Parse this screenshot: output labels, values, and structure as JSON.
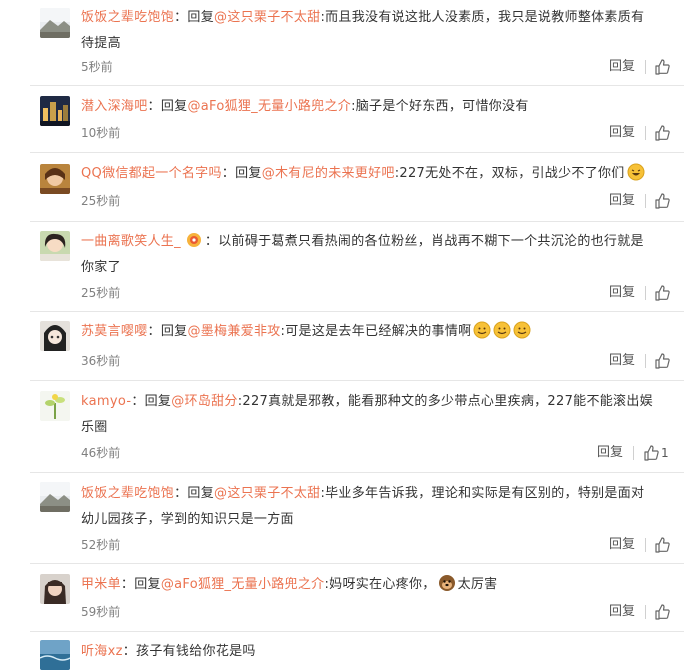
{
  "reply_label": "回复",
  "colon": "：",
  "comments": [
    {
      "user": "饭饭之辈吃饱饱",
      "prefix": "回复",
      "mention": "@这只栗子不太甜",
      "body_line1": ":而且我没有说这批人没素质，我只是说教师整体素质有",
      "body_line2": "待提高",
      "time": "5秒前",
      "avatar": "landscape"
    },
    {
      "user": "潜入深海吧",
      "prefix": "回复",
      "mention": "@aFo狐狸_无量小路兜之介",
      "body_line1": ":脑子是个好东西，可惜你没有",
      "time": "10秒前",
      "avatar": "night-city"
    },
    {
      "user": "QQ微信都起一个名字吗",
      "prefix": "回复",
      "mention": "@木有尼的未来更好吧",
      "body_line1": ":227无处不在，双标，引战少不了你们",
      "time": "25秒前",
      "avatar": "portrait"
    },
    {
      "user": "一曲离歌笑人生_",
      "body_line1": "以前碍于葛煮只看热闹的各位粉丝，肖战再不糊下一个共沉沦的也行就是",
      "body_line2": "你家了",
      "time": "25秒前",
      "avatar": "girl"
    },
    {
      "user": "苏莫言嘤嘤",
      "prefix": "回复",
      "mention": "@墨梅兼爱非攻",
      "body_line1": ":可是这是去年已经解决的事情啊",
      "time": "36秒前",
      "avatar": "anime"
    },
    {
      "user": "kamyo-",
      "prefix": "回复",
      "mention": "@环岛甜分",
      "body_line1": ":227真就是邪教，能看那种文的多少带点心里疾病，227能不能滚出娱",
      "body_line2": "乐圈",
      "time": "46秒前",
      "like_count": "1",
      "avatar": "plant"
    },
    {
      "user": "饭饭之辈吃饱饱",
      "prefix": "回复",
      "mention": "@这只栗子不太甜",
      "body_line1": ":毕业多年告诉我，理论和实际是有区别的，特别是面对",
      "body_line2": "幼儿园孩子，学到的知识只是一方面",
      "time": "52秒前",
      "avatar": "landscape"
    },
    {
      "user": "甲米单",
      "prefix": "回复",
      "mention": "@aFo狐狸_无量小路兜之介",
      "body_line1": ":妈呀实在心疼你，",
      "body_after_emoji": "太厉害",
      "time": "59秒前",
      "avatar": "woman"
    },
    {
      "user": "听海xz",
      "body_line1": "孩子有钱给你花是吗",
      "avatar": "sea"
    }
  ]
}
